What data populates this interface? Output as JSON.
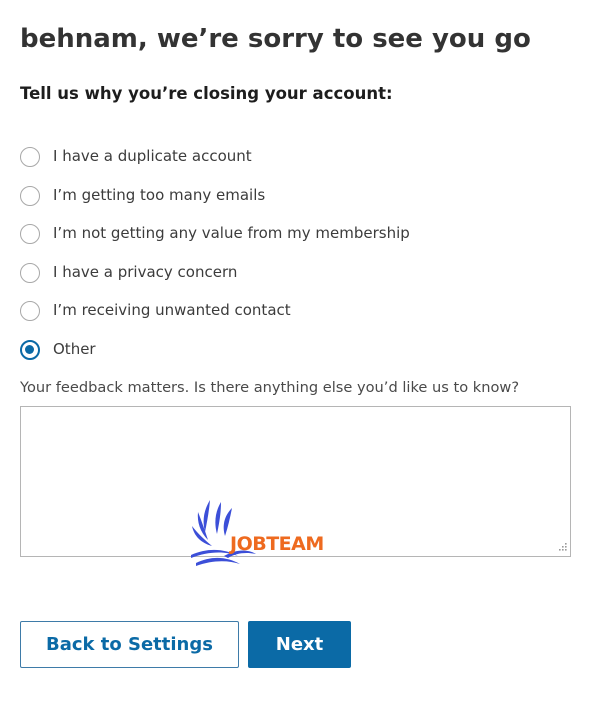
{
  "page": {
    "title": "behnam, we’re sorry to see you go",
    "subtitle": "Tell us why you’re closing your account:"
  },
  "reasons": [
    {
      "label": "I have a duplicate account",
      "checked": false
    },
    {
      "label": "I’m getting too many emails",
      "checked": false
    },
    {
      "label": "I’m not getting any value from my membership",
      "checked": false
    },
    {
      "label": "I have a privacy concern",
      "checked": false
    },
    {
      "label": "I’m receiving unwanted contact",
      "checked": false
    },
    {
      "label": "Other",
      "checked": true
    }
  ],
  "feedback": {
    "label": "Your feedback matters. Is there anything else you’d like us to know?",
    "value": "",
    "placeholder": ""
  },
  "watermark": {
    "text": "JOBTEAM"
  },
  "buttons": {
    "back_label": "Back to Settings",
    "next_label": "Next"
  },
  "colors": {
    "accent": "#0b6aa6",
    "watermark_blue": "#3c4fd8",
    "watermark_orange": "#ee6a1f"
  },
  "icons": {
    "radio_unchecked": "radio-unchecked-icon",
    "radio_checked": "radio-checked-icon",
    "resize": "resize-grip-icon",
    "watermark_logo": "jobteam-logo"
  }
}
